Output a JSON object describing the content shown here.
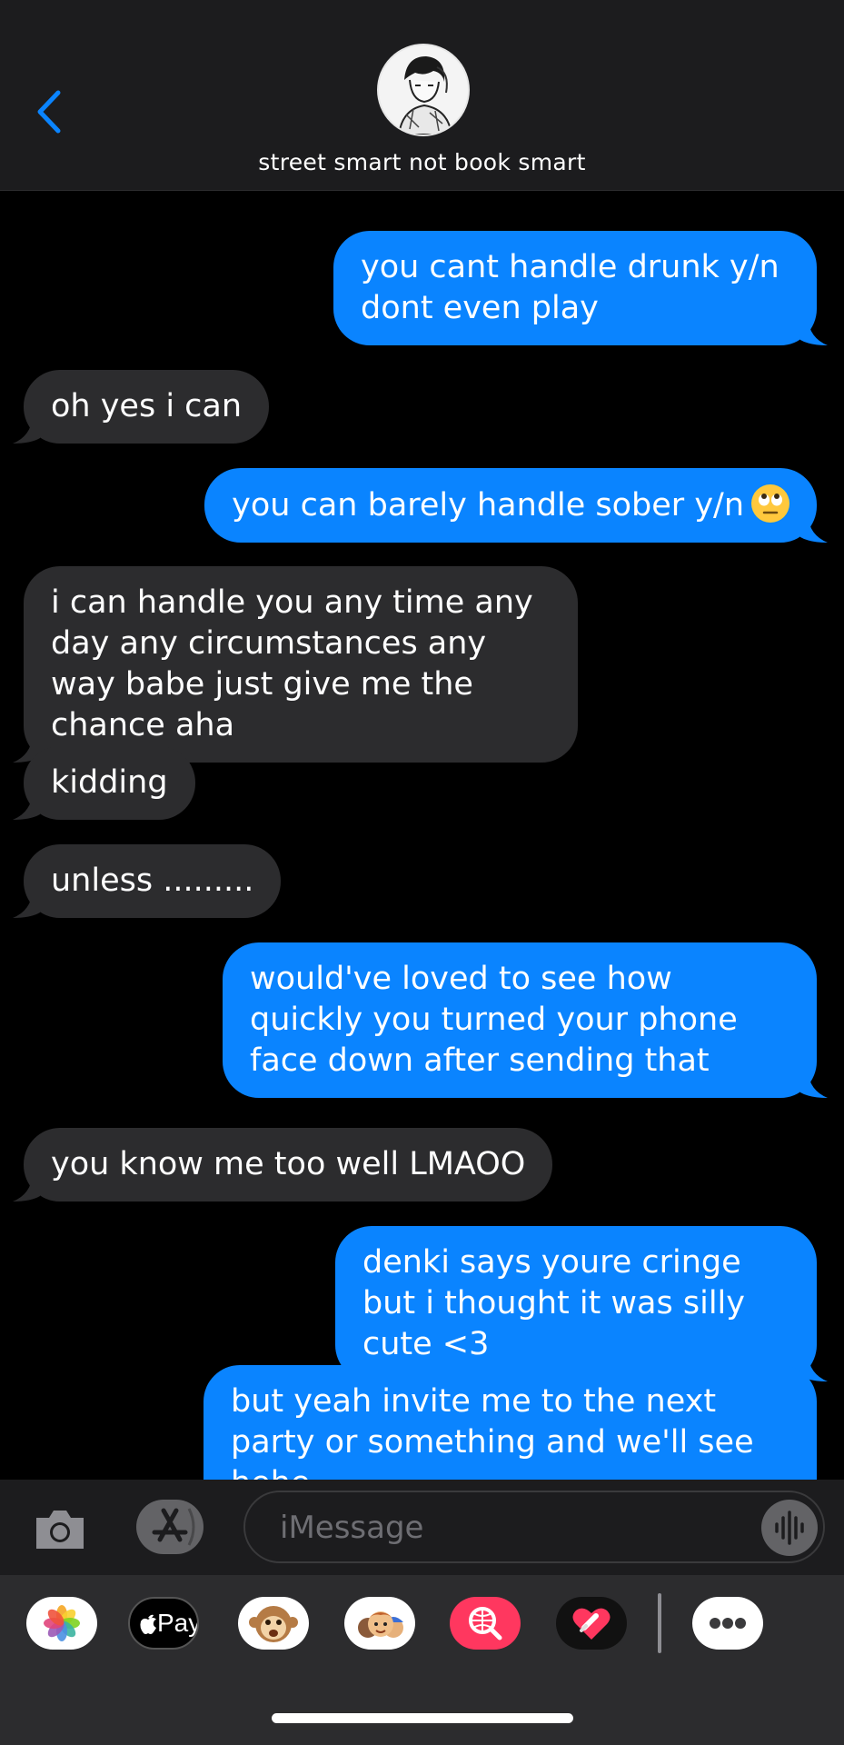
{
  "header": {
    "contact_name": "street smart not book smart"
  },
  "messages": [
    {
      "from": "me",
      "text": "you cant handle drunk y/n dont even play"
    },
    {
      "from": "them",
      "text": "oh yes i can"
    },
    {
      "from": "me",
      "text": "you can barely handle sober y/n",
      "emoji": "eye-roll-emoji"
    },
    {
      "from": "them",
      "text": "i can handle you any time any day any circumstances any way babe just give me the chance aha"
    },
    {
      "from": "them",
      "text": "kidding"
    },
    {
      "from": "them",
      "text": "unless ........."
    },
    {
      "from": "me",
      "text": "would've loved to see how quickly you turned your phone face down after sending that"
    },
    {
      "from": "them",
      "text": "you know me too well LMAOO"
    },
    {
      "from": "me",
      "text": "denki says youre cringe but i thought it was silly cute <3"
    },
    {
      "from": "me",
      "text": "but yeah invite me to the next party or something and we'll see hehe"
    }
  ],
  "input": {
    "placeholder": "iMessage",
    "value": ""
  },
  "tray": {
    "apple_pay_label": "Pay",
    "apps": [
      "photos-icon",
      "apple-pay-icon",
      "animoji-icon",
      "memoji-icon",
      "image-search-icon",
      "digital-touch-icon",
      "more-icon"
    ]
  },
  "colors": {
    "sent_bubble": "#0a84ff",
    "received_bubble": "#2c2c2e",
    "accent": "#0a84ff"
  }
}
